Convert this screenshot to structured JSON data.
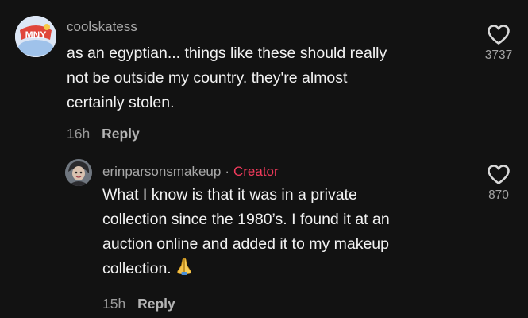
{
  "comments": [
    {
      "username": "coolskatess",
      "text": "as an egyptian... things like these should really not be outside my country. they're almost certainly stolen.",
      "line1": "as an egyptian... things like these should really",
      "line2": "not be outside my country. they're almost",
      "line3": "certainly stolen.",
      "time": "16h",
      "reply_label": "Reply",
      "likes": "3737",
      "avatar_icon": "avatar-illustration-icon",
      "avatar_text": "MNY"
    },
    {
      "username": "erinparsonsmakeup",
      "separator": "·",
      "badge": "Creator",
      "line1": "What I know is that it was in a private",
      "line2": "collection since the 1980’s. I found it at an",
      "line3": "auction online and added it to my makeup",
      "line4": "collection.",
      "emoji": "praying-hands-icon",
      "time": "15h",
      "reply_label": "Reply",
      "likes": "870",
      "avatar_icon": "avatar-photo-icon"
    }
  ],
  "colors": {
    "background": "#121212",
    "text": "#f2f2f2",
    "secondary": "#a9a9a9",
    "creator_badge": "#f23b5c"
  }
}
